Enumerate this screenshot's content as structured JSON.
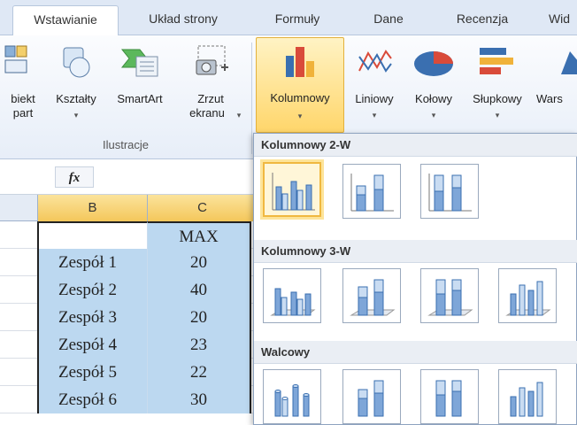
{
  "ribbon_tabs": [
    "Wstawianie",
    "Układ strony",
    "Formuły",
    "Dane",
    "Recenzja",
    "Wid"
  ],
  "ribbon": {
    "buttons": [
      {
        "label_line1": "biekt",
        "label_line2": "part",
        "icon": "object-icon"
      },
      {
        "label_line1": "Kształty",
        "label_line2": "",
        "icon": "shapes-icon",
        "dropdown": true
      },
      {
        "label_line1": "SmartArt",
        "label_line2": "",
        "icon": "smartart-icon"
      },
      {
        "label_line1": "Zrzut",
        "label_line2": "ekranu",
        "icon": "screenshot-icon",
        "dropdown": true
      },
      {
        "label_line1": "Kolumnowy",
        "label_line2": "",
        "icon": "column-chart-icon",
        "dropdown": true,
        "selected": true
      },
      {
        "label_line1": "Liniowy",
        "label_line2": "",
        "icon": "line-chart-icon",
        "dropdown": true
      },
      {
        "label_line1": "Kołowy",
        "label_line2": "",
        "icon": "pie-chart-icon",
        "dropdown": true
      },
      {
        "label_line1": "Słupkowy",
        "label_line2": "",
        "icon": "bar-chart-icon",
        "dropdown": true
      },
      {
        "label_line1": "Wars",
        "label_line2": "",
        "icon": "area-chart-icon"
      }
    ],
    "group_label": "Ilustracje",
    "dropdown_arrow": "▾"
  },
  "formula_bar": {
    "fx_label": "fx"
  },
  "sheet": {
    "columns": [
      "B",
      "C"
    ],
    "header_value": "MAX",
    "rows": [
      {
        "name": "Zespół 1",
        "max": "20"
      },
      {
        "name": "Zespół 2",
        "max": "40"
      },
      {
        "name": "Zespół 3",
        "max": "20"
      },
      {
        "name": "Zespół 4",
        "max": "23"
      },
      {
        "name": "Zespół 5",
        "max": "22"
      },
      {
        "name": "Zespół 6",
        "max": "30"
      }
    ]
  },
  "chart_dropdown": {
    "sections": [
      {
        "title": "Kolumnowy 2-W",
        "styles": [
          "clustered-2d",
          "stacked-2d",
          "stacked100-2d"
        ]
      },
      {
        "title": "Kolumnowy 3-W",
        "styles": [
          "clustered-3d",
          "stacked-3d",
          "stacked100-3d",
          "column-3d"
        ]
      },
      {
        "title": "Walcowy",
        "styles": [
          "cylinder-clustered",
          "cylinder-stacked",
          "cylinder-stacked100",
          "cylinder-3d"
        ]
      }
    ]
  },
  "colors": {
    "accent_selected": "#ffd66b",
    "cell_fill": "#bcd8f0",
    "ribbon_bg": "#dfe8f5"
  }
}
